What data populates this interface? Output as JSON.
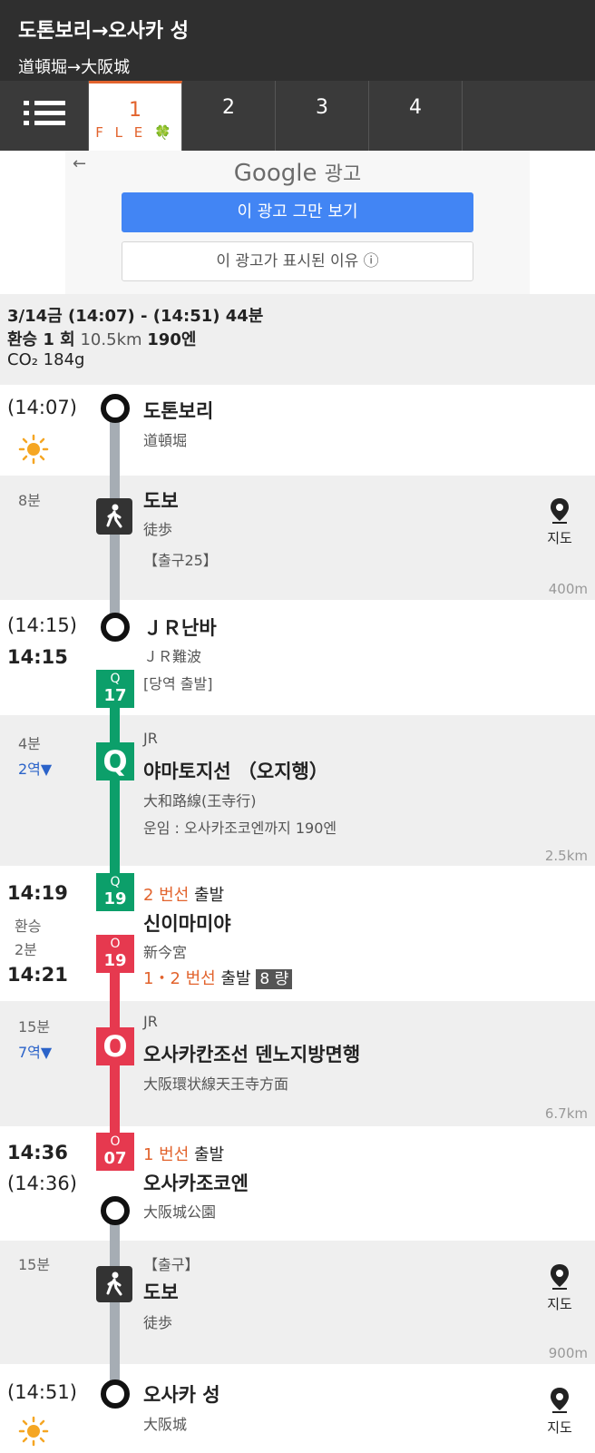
{
  "header": {
    "title": "도톤보리→오사카 성",
    "subtitle": "道頓堀→大阪城"
  },
  "tabs": [
    {
      "label": "1",
      "sub": "F L E 🍀"
    },
    {
      "label": "2"
    },
    {
      "label": "3"
    },
    {
      "label": "4"
    }
  ],
  "ad": {
    "back": "←",
    "google": "Google",
    "ad_label": "광고",
    "stop_label": "이 광고 그만 보기",
    "why_label": "이 광고가 표시된 이유 ⓘ"
  },
  "summary": {
    "line1": "3/14금 (14:07) - (14:51) 44분",
    "transfers": "환승 1 회",
    "distance": "10.5km",
    "fare": "190엔",
    "co2": "CO₂ 184g"
  },
  "colors": {
    "jr_green": "#0c9f6a",
    "osaka_red": "#e6394f",
    "walk_grey": "#a6adb4",
    "accent": "#e2632d"
  },
  "steps": {
    "s1": {
      "time": "(14:07)",
      "name": "도톤보리",
      "sub": "道頓堀",
      "icon": "sun-icon"
    },
    "w1": {
      "duration": "8분",
      "title": "도보",
      "sub": "徒歩",
      "exit": "【출구25】",
      "distance": "400m",
      "map": "지도"
    },
    "s2": {
      "time1": "(14:15)",
      "time2": "14:15",
      "name": "ＪＲ난바",
      "sub": "ＪＲ難波",
      "note": "[당역 출발]",
      "badge_line": "Q",
      "badge_num": "17"
    },
    "r1": {
      "duration": "4분",
      "stops": "2역▼",
      "operator": "JR",
      "line_letter": "Q",
      "name": "야마토지선 （오지행）",
      "sub": "大和路線(王寺行)",
      "fare": "운임 : 오사카조코엔까지 190엔",
      "distance": "2.5km"
    },
    "s3": {
      "time1": "14:19",
      "transfer": "환승",
      "transfer_dur": "2분",
      "time2": "14:21",
      "platform1": "2 번선",
      "depart": "출발",
      "name": "신이마미야",
      "sub": "新今宮",
      "platform2": "1・2 번선",
      "depart2": "출발",
      "cars": "8 량",
      "badge1_line": "Q",
      "badge1_num": "19",
      "badge2_line": "O",
      "badge2_num": "19"
    },
    "r2": {
      "duration": "15분",
      "stops": "7역▼",
      "operator": "JR",
      "line_letter": "O",
      "name": "오사카칸조선 덴노지방면행",
      "sub": "大阪環状線天王寺方面",
      "distance": "6.7km"
    },
    "s4": {
      "time1": "14:36",
      "time2": "(14:36)",
      "platform": "1 번선",
      "depart": "출발",
      "name": "오사카조코엔",
      "sub": "大阪城公園",
      "badge_line": "O",
      "badge_num": "07"
    },
    "w2": {
      "duration": "15분",
      "exit": "【출구】",
      "title": "도보",
      "sub": "徒歩",
      "distance": "900m",
      "map": "지도"
    },
    "s5": {
      "time": "(14:51)",
      "name": "오사카 성",
      "sub": "大阪城",
      "map": "지도",
      "icon": "sun-icon"
    }
  }
}
